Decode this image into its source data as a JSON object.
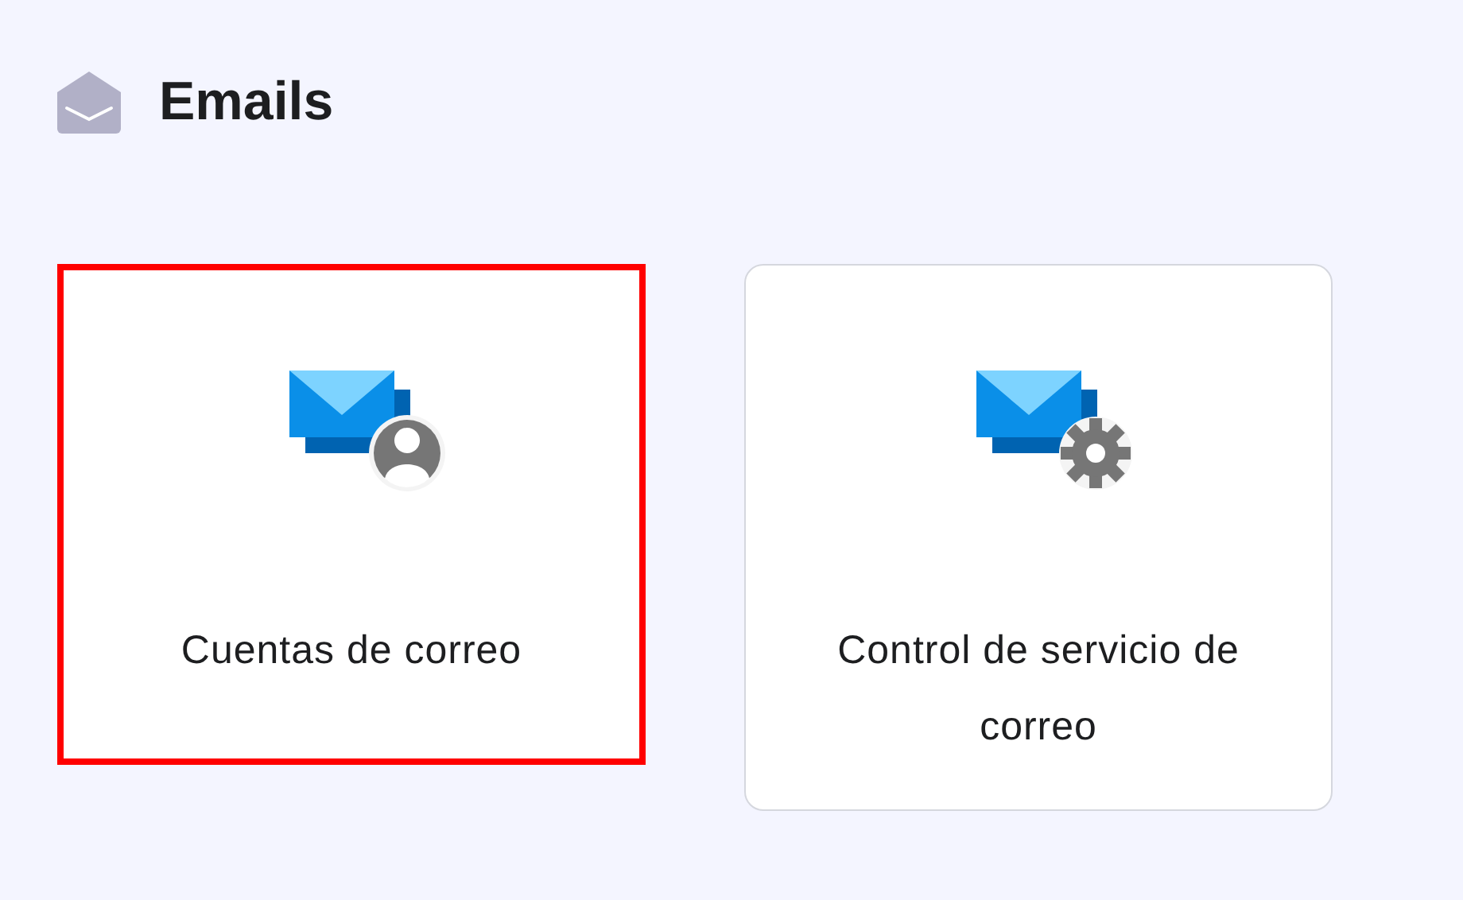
{
  "header": {
    "title": "Emails"
  },
  "cards": [
    {
      "label": "Cuentas de correo",
      "kind": "person",
      "selected": true
    },
    {
      "label": "Control de servicio de correo",
      "kind": "gear",
      "selected": false
    }
  ]
}
